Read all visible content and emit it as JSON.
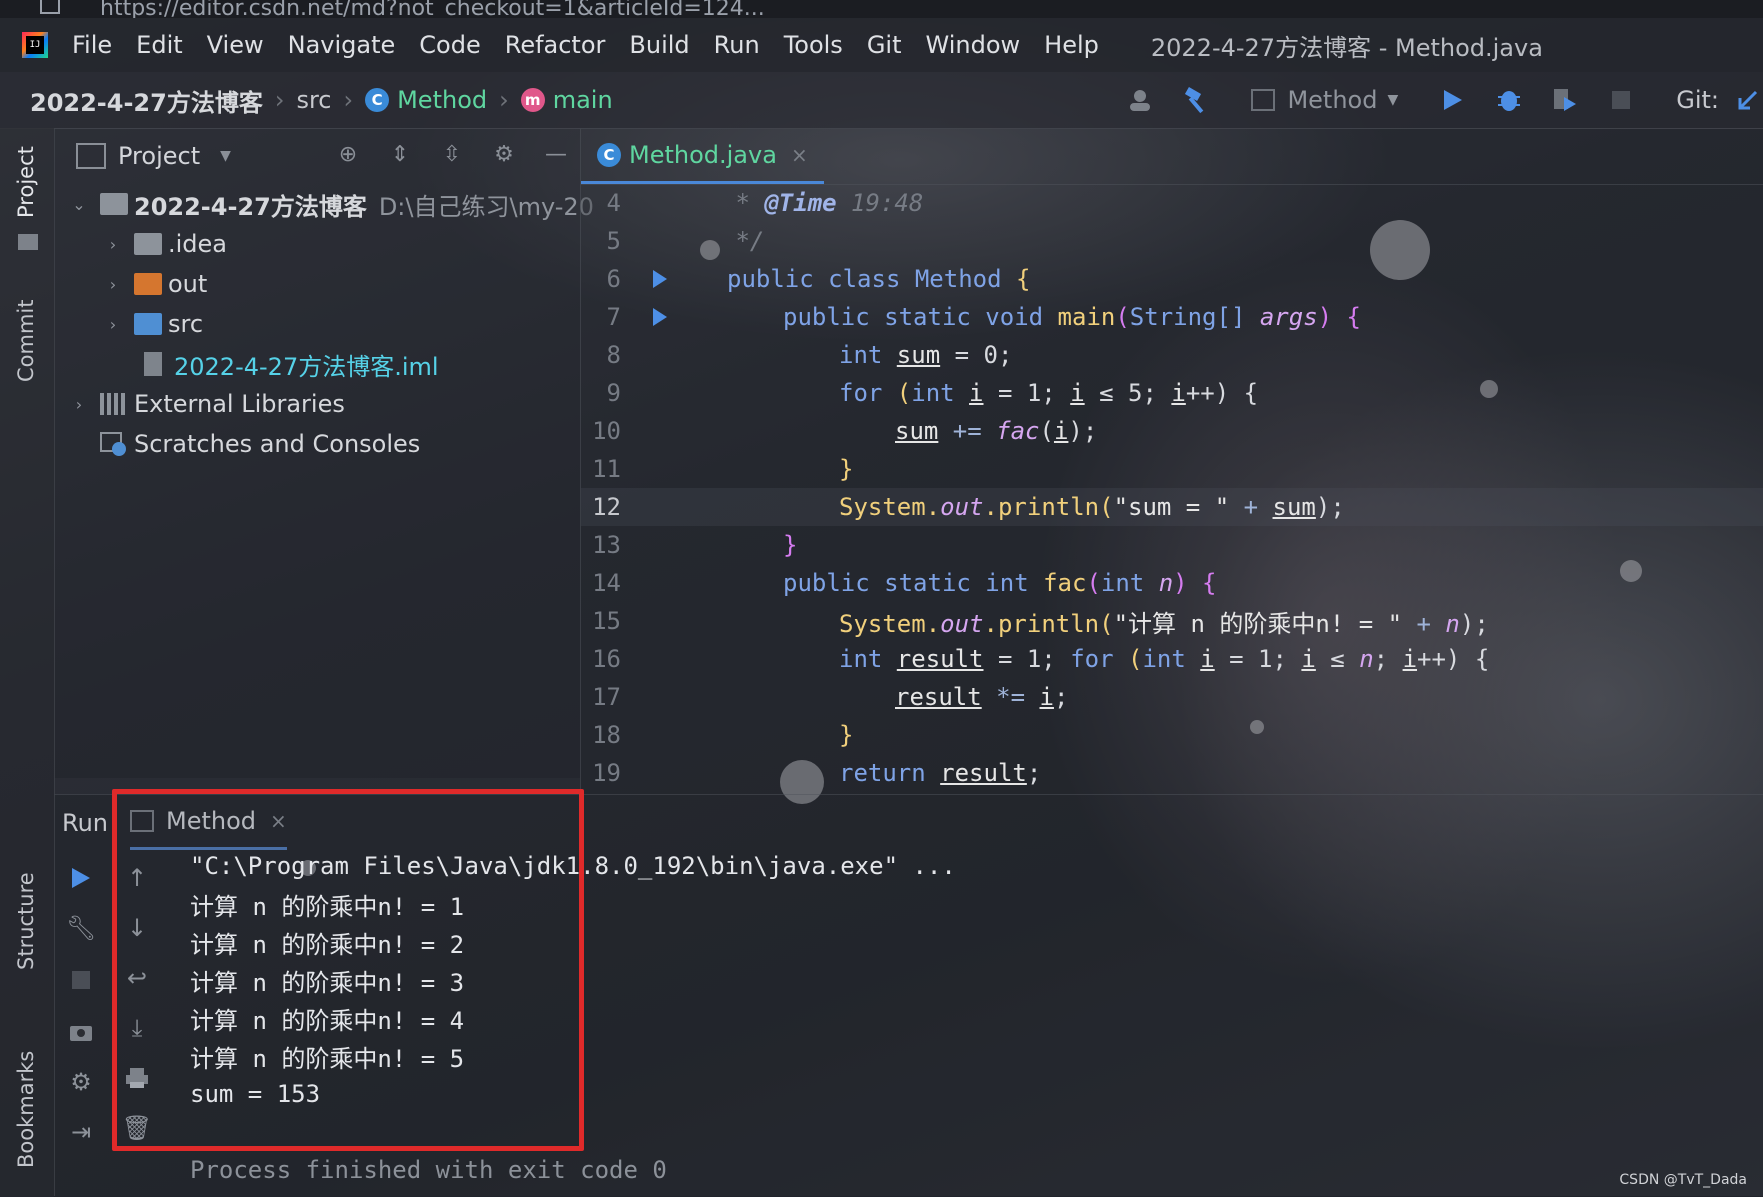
{
  "browser": {
    "url": "https://editor.csdn.net/md?not_checkout=1&articleId=124..."
  },
  "menubar": {
    "items": [
      {
        "label": "File"
      },
      {
        "label": "Edit"
      },
      {
        "label": "View"
      },
      {
        "label": "Navigate"
      },
      {
        "label": "Code"
      },
      {
        "label": "Refactor"
      },
      {
        "label": "Build"
      },
      {
        "label": "Run"
      },
      {
        "label": "Tools"
      },
      {
        "label": "Git"
      },
      {
        "label": "Window"
      },
      {
        "label": "Help"
      }
    ],
    "window_title": "2022-4-27方法博客 - Method.java"
  },
  "navbar": {
    "project": "2022-4-27方法博客",
    "src": "src",
    "class_badge": "C",
    "class_name": "Method",
    "method_badge": "m",
    "method_name": "main",
    "run_config": "Method",
    "git_label": "Git:"
  },
  "left_stripe": {
    "project_tab": "Project",
    "commit_tab": "Commit",
    "structure_tab": "Structure",
    "bookmarks_tab": "Bookmarks"
  },
  "project_panel": {
    "title": "Project",
    "tree": {
      "root": {
        "name": "2022-4-27方法博客",
        "path": "D:\\自己练习\\my-20"
      },
      "idea": ".idea",
      "out": "out",
      "src": "src",
      "iml": "2022-4-27方法博客.iml",
      "libs": "External Libraries",
      "scratches": "Scratches and Consoles"
    }
  },
  "editor": {
    "tab_label": "Method.java",
    "tab_badge": "C",
    "line_numbers": [
      "4",
      "5",
      "6",
      "7",
      "8",
      "9",
      "10",
      "11",
      "12",
      "13",
      "14",
      "15",
      "16",
      "17",
      "18",
      "19"
    ],
    "code": {
      "l4_tag": "@Time",
      "l4_val": " 19:48",
      "l4_star": " *",
      "l5": " */",
      "l6_kw": "public class ",
      "l6_cls": "Method",
      "l6_brace": " {",
      "l7_kw": "public static void ",
      "l7_fn": "main",
      "l7_open": "(",
      "l7_type": "String[] ",
      "l7_param": "args",
      "l7_close": ") {",
      "l8_kw": "int ",
      "l8_var": "sum",
      "l8_rest": " = 0;",
      "l9_kw": "for ",
      "l9_a": "(",
      "l9_kw2": "int ",
      "l9_i1": "i",
      "l9_b": " = 1; ",
      "l9_i2": "i",
      "l9_c": " ≤ 5; ",
      "l9_i3": "i",
      "l9_d": "++) {",
      "l10_var": "sum",
      "l10_op": " += ",
      "l10_fn": "fac",
      "l10_a": "(",
      "l10_i": "i",
      "l10_b": ");",
      "l11": "}",
      "l12_sys": "System.",
      "l12_out": "out",
      "l12_print": ".println(",
      "l12_str": "\"sum = \"",
      "l12_plus": " + ",
      "l12_var": "sum",
      "l12_end": ");",
      "l13": "}",
      "l14_kw": "public static int ",
      "l14_fn": "fac",
      "l14_a": "(",
      "l14_kw2": "int ",
      "l14_param": "n",
      "l14_b": ") {",
      "l15_sys": "System.",
      "l15_out": "out",
      "l15_print": ".println(",
      "l15_str": "\"计算 n 的阶乘中n! = \"",
      "l15_plus": " + ",
      "l15_param": "n",
      "l15_end": ");",
      "l16_kw": "int ",
      "l16_var": "result",
      "l16_a": " = 1; ",
      "l16_for": "for ",
      "l16_b": "(",
      "l16_kw2": "int ",
      "l16_i1": "i",
      "l16_c": " = 1; ",
      "l16_i2": "i",
      "l16_d": " ≤ ",
      "l16_n": "n",
      "l16_e": "; ",
      "l16_i3": "i",
      "l16_f": "++) {",
      "l17_var": "result",
      "l17_op": " *= ",
      "l17_i": "i",
      "l17_end": ";",
      "l18": "}",
      "l19_kw": "return ",
      "l19_var": "result",
      "l19_end": ";"
    }
  },
  "run_panel": {
    "label": "Run",
    "tab": "Method",
    "console": [
      "\"C:\\Program Files\\Java\\jdk1.8.0_192\\bin\\java.exe\" ...",
      "计算 n 的阶乘中n! = 1",
      "计算 n 的阶乘中n! = 2",
      "计算 n 的阶乘中n! = 3",
      "计算 n 的阶乘中n! = 4",
      "计算 n 的阶乘中n! = 5",
      "sum = 153",
      "",
      "Process finished with exit code 0"
    ]
  },
  "watermark": "CSDN @TvT_Dada",
  "colors": {
    "accent_blue": "#4d8fe6",
    "class_green": "#5fd6a0",
    "highlight_red": "#e02a2a"
  }
}
